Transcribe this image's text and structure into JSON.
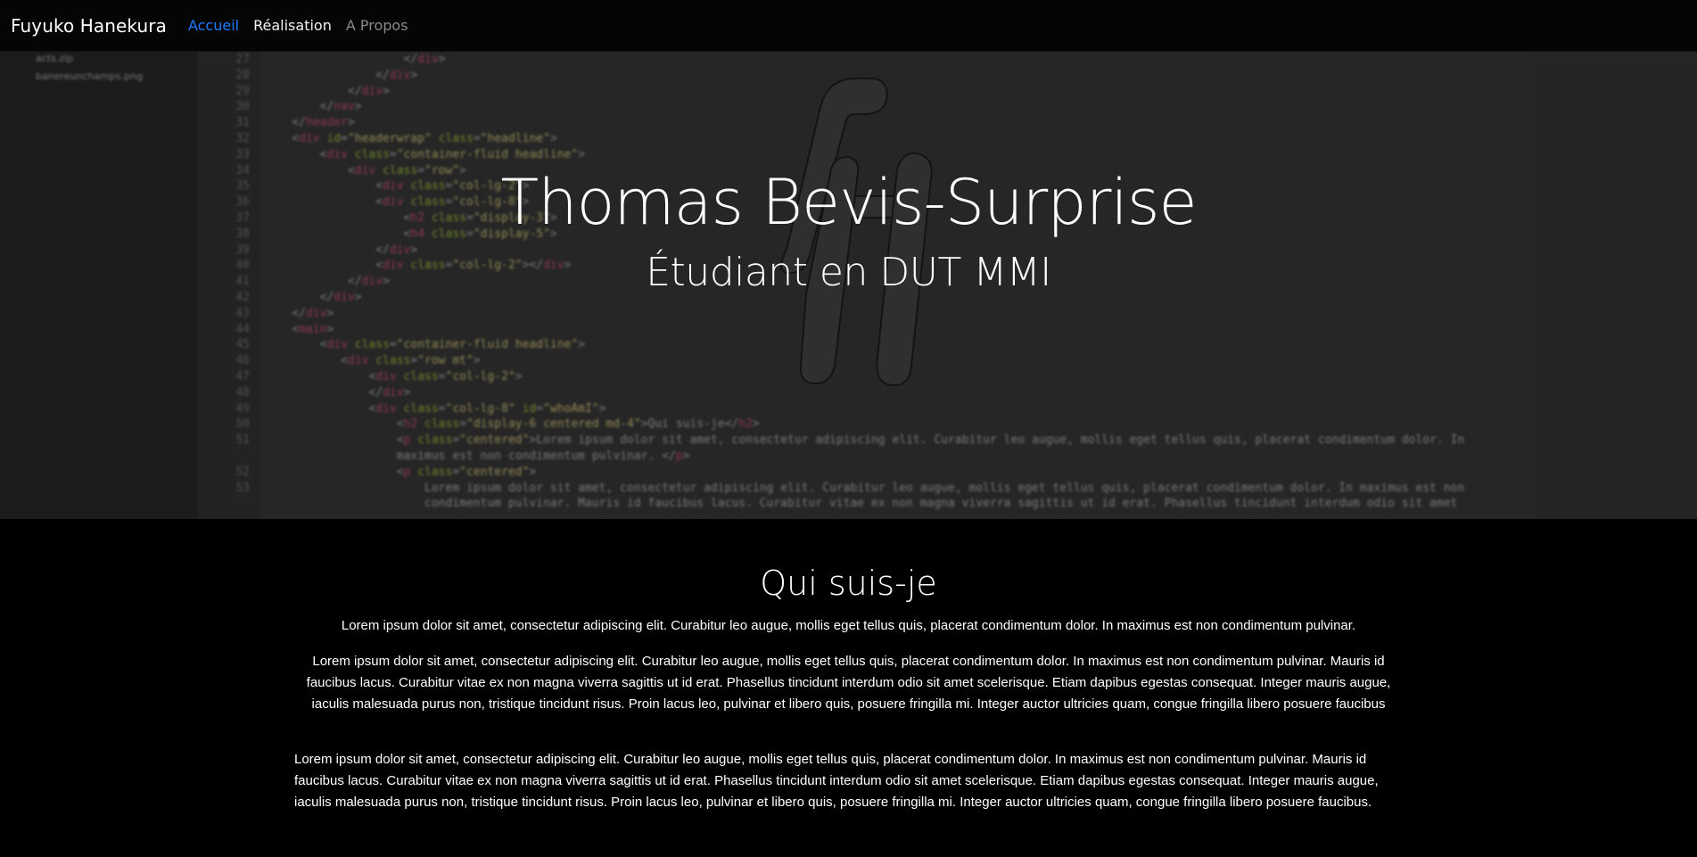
{
  "nav": {
    "brand": "Fuyuko Hanekura",
    "links": [
      {
        "label": "Accueil",
        "state": "active"
      },
      {
        "label": "Réalisation",
        "state": "normal"
      },
      {
        "label": "A Propos",
        "state": "muted"
      }
    ]
  },
  "hero": {
    "title": "Thomas Bevis-Surprise",
    "subtitle": "Étudiant en DUT MMI",
    "logo_icon": "fh-monogram-icon"
  },
  "about": {
    "title": "Qui suis-je",
    "paragraph1": "Lorem ipsum dolor sit amet, consectetur adipiscing elit. Curabitur leo augue, mollis eget tellus quis, placerat condimentum dolor. In maximus est non condimentum pulvinar.",
    "paragraph2": "Lorem ipsum dolor sit amet, consectetur adipiscing elit. Curabitur leo augue, mollis eget tellus quis, placerat condimentum dolor. In maximus est non condimentum pulvinar. Mauris id faucibus lacus. Curabitur vitae ex non magna viverra sagittis ut id erat. Phasellus tincidunt interdum odio sit amet scelerisque. Etiam dapibus egestas consequat. Integer mauris augue, iaculis malesuada purus non, tristique tincidunt risus. Proin lacus leo, pulvinar et libero quis, posuere fringilla mi. Integer auctor ultricies quam, congue fringilla libero posuere faucibus",
    "paragraph3": "Lorem ipsum dolor sit amet, consectetur adipiscing elit. Curabitur leo augue, mollis eget tellus quis, placerat condimentum dolor. In maximus est non condimentum pulvinar. Mauris id faucibus lacus. Curabitur vitae ex non magna viverra sagittis ut id erat. Phasellus tincidunt interdum odio sit amet scelerisque. Etiam dapibus egestas consequat. Integer mauris augue, iaculis malesuada purus non, tristique tincidunt risus. Proin lacus leo, pulvinar et libero quis, posuere fringilla mi. Integer auctor ultricies quam, congue fringilla libero posuere faucibus."
  },
  "colors": {
    "active_link": "#1f7bff",
    "background": "#000000"
  }
}
